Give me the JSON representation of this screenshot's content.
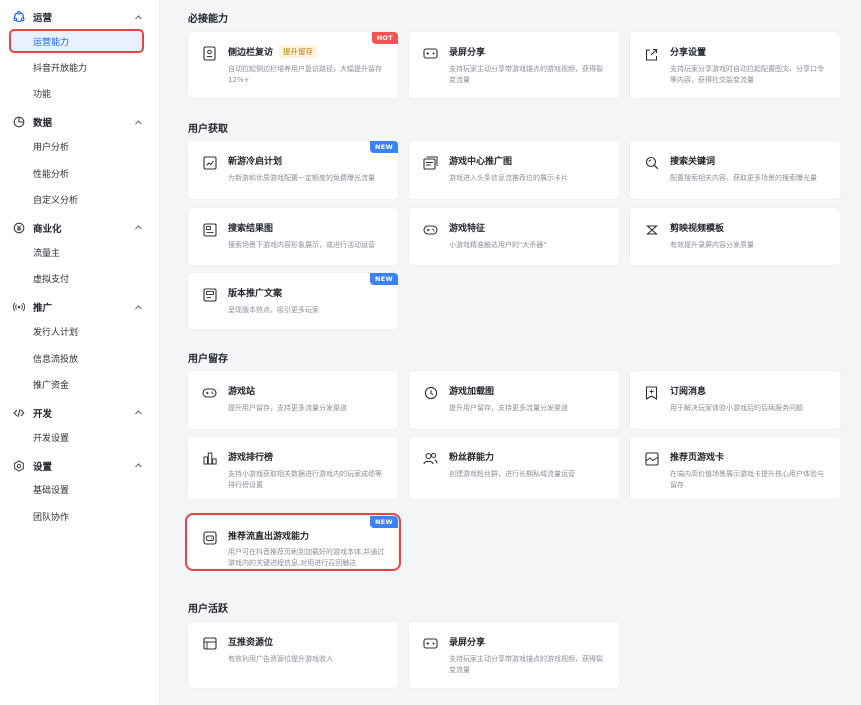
{
  "sidebar": {
    "groups": [
      {
        "label": "运营",
        "icon": "operations-icon",
        "items": [
          "运营能力",
          "抖音开放能力",
          "功能"
        ]
      },
      {
        "label": "数据",
        "icon": "pie-chart-icon",
        "items": [
          "用户分析",
          "性能分析",
          "自定义分析"
        ]
      },
      {
        "label": "商业化",
        "icon": "monetization-icon",
        "items": [
          "流量主",
          "虚拟支付"
        ]
      },
      {
        "label": "推广",
        "icon": "broadcast-icon",
        "items": [
          "发行人计划",
          "信息流投放",
          "推广资金"
        ]
      },
      {
        "label": "开发",
        "icon": "code-icon",
        "items": [
          "开发设置"
        ]
      },
      {
        "label": "设置",
        "icon": "settings-icon",
        "items": [
          "基础设置",
          "团队协作"
        ]
      }
    ]
  },
  "sections": [
    {
      "title": "必接能力",
      "cards": [
        {
          "title": "侧边栏复访",
          "tag": "提升留存",
          "badge": "HOT",
          "desc": "自动拉起侧边栏培养用户复访路径，大幅提升留存12%+"
        },
        {
          "title": "录屏分享",
          "desc": "支持玩家主动分享带游戏锚点的游戏视频，获得裂变流量"
        },
        {
          "title": "分享设置",
          "desc": "支持玩家分享游戏时自动拉起配置图文、分享口令等内容，获得社交裂变流量"
        }
      ]
    },
    {
      "title": "用户获取",
      "cards": [
        {
          "title": "新游冷启计划",
          "badge": "NEW",
          "desc": "为新游和优质游戏配置一定额度的免费曝光流量"
        },
        {
          "title": "游戏中心推广图",
          "desc": "游戏进入头条信息流推荐位的展示卡片"
        },
        {
          "title": "搜索关键词",
          "desc": "配置搜索相关内容，获取更多场景的搜索曝光量"
        },
        {
          "title": "搜索结果图",
          "desc": "搜索场景下游戏内容形象展示，或进行活动运营"
        },
        {
          "title": "游戏特征",
          "desc": "小游戏精准触达用户的\"大杀器\""
        },
        {
          "title": "剪映视频模板",
          "desc": "有效提升录屏内容分发质量"
        },
        {
          "title": "版本推广文案",
          "badge": "NEW",
          "desc": "呈现版本热点，吸引更多玩家"
        }
      ]
    },
    {
      "title": "用户留存",
      "cards": [
        {
          "title": "游戏站",
          "desc": "提升用户留存，支持更多流量分发渠道"
        },
        {
          "title": "游戏加载图",
          "desc": "提升用户留存，支持更多流量分发渠道"
        },
        {
          "title": "订阅消息",
          "desc": "用于解决玩家体验小游戏后的后续服务问题"
        },
        {
          "title": "游戏排行榜",
          "desc": "支持小游戏获取相关数据进行游戏内的玩家成绩等排行榜设置"
        },
        {
          "title": "粉丝群能力",
          "desc": "创建游戏粉丝群，进行长期私域流量运营"
        },
        {
          "title": "推荐页游戏卡",
          "desc": "在端内高价值场景展示游戏卡提升核心用户体验与留存"
        },
        {
          "title": "推荐流直出游戏能力",
          "badge": "NEW",
          "desc": "用户可在抖音推荐页刷到加载好的游戏本体,并通过游戏内的关键进程信息,对用进行召回触达"
        }
      ]
    },
    {
      "title": "用户活跃",
      "cards": [
        {
          "title": "互推资源位",
          "desc": "有效利用广告资源位提升游戏收入"
        },
        {
          "title": "录屏分享",
          "desc": "支持玩家主动分享带游戏锚点的游戏视频，获得裂变流量"
        }
      ]
    }
  ],
  "colors": {
    "accent": "#1664ff",
    "highlight": "#e64545",
    "hot": "#f05454",
    "new": "#3b82f6"
  }
}
